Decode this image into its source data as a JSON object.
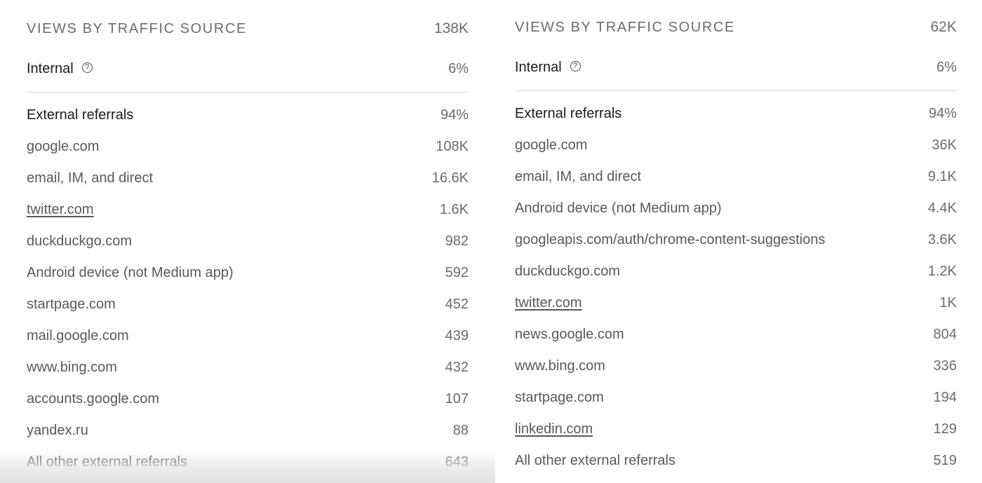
{
  "left_panel": {
    "title": "VIEWS BY TRAFFIC SOURCE",
    "total": "138K",
    "internal": {
      "label": "Internal",
      "value": "6%",
      "help_icon": "question-circle-icon"
    },
    "external": {
      "label": "External referrals",
      "value": "94%"
    },
    "rows": [
      {
        "label": "google.com",
        "value": "108K",
        "link": false
      },
      {
        "label": "email, IM, and direct",
        "value": "16.6K",
        "link": false
      },
      {
        "label": "twitter.com",
        "value": "1.6K",
        "link": true
      },
      {
        "label": "duckduckgo.com",
        "value": "982",
        "link": false
      },
      {
        "label": "Android device (not Medium app)",
        "value": "592",
        "link": false
      },
      {
        "label": "startpage.com",
        "value": "452",
        "link": false
      },
      {
        "label": "mail.google.com",
        "value": "439",
        "link": false
      },
      {
        "label": "www.bing.com",
        "value": "432",
        "link": false
      },
      {
        "label": "accounts.google.com",
        "value": "107",
        "link": false
      },
      {
        "label": "yandex.ru",
        "value": "88",
        "link": false
      },
      {
        "label": "All other external referrals",
        "value": "643",
        "link": false
      }
    ]
  },
  "right_panel": {
    "title": "VIEWS BY TRAFFIC SOURCE",
    "total": "62K",
    "internal": {
      "label": "Internal",
      "value": "6%",
      "help_icon": "question-circle-icon"
    },
    "external": {
      "label": "External referrals",
      "value": "94%"
    },
    "rows": [
      {
        "label": "google.com",
        "value": "36K",
        "link": false
      },
      {
        "label": "email, IM, and direct",
        "value": "9.1K",
        "link": false
      },
      {
        "label": "Android device (not Medium app)",
        "value": "4.4K",
        "link": false
      },
      {
        "label": "googleapis.com/auth/chrome-content-suggestions",
        "value": "3.6K",
        "link": false
      },
      {
        "label": "duckduckgo.com",
        "value": "1.2K",
        "link": false
      },
      {
        "label": "twitter.com",
        "value": "1K",
        "link": true
      },
      {
        "label": "news.google.com",
        "value": "804",
        "link": false
      },
      {
        "label": "www.bing.com",
        "value": "336",
        "link": false
      },
      {
        "label": "startpage.com",
        "value": "194",
        "link": false
      },
      {
        "label": "linkedin.com",
        "value": "129",
        "link": true
      },
      {
        "label": "All other external referrals",
        "value": "519",
        "link": false
      }
    ]
  },
  "colors": {
    "text_primary": "#1a1a1a",
    "text_secondary": "#595959",
    "divider": "#dcdcdc"
  }
}
